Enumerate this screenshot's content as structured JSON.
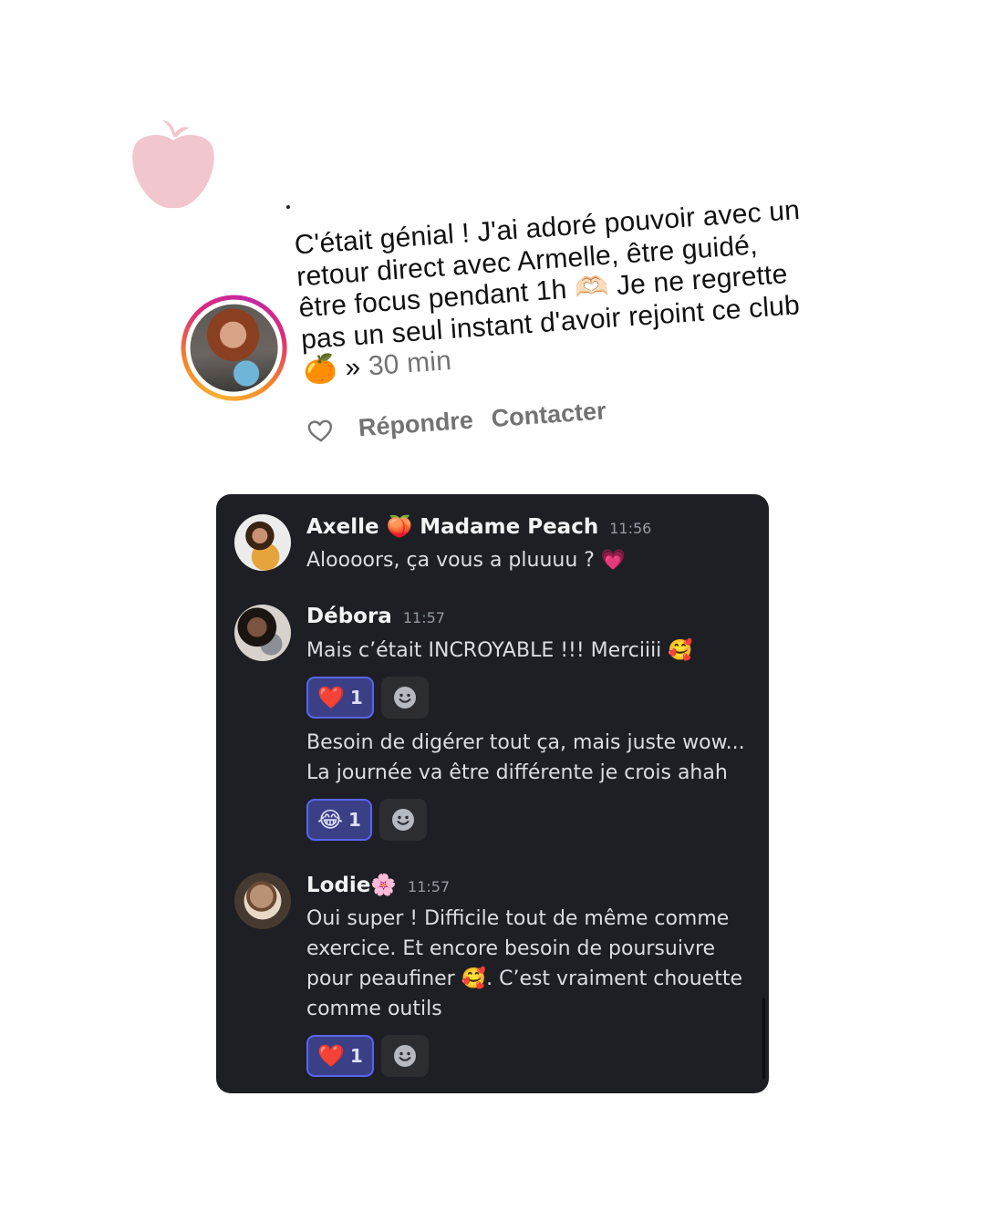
{
  "brand": {
    "logo_icon": "apple-icon",
    "logo_color": "#f2c6cf"
  },
  "instagram": {
    "comment_text": "C'était génial ! J'ai adoré pouvoir avec un retour direct avec Armelle, être guidé, être focus pendant 1h 🫶🏻 Je ne regrette pas un seul instant d'avoir rejoint ce club 🍊 »",
    "time": "30 min",
    "reply_label": "Répondre",
    "contact_label": "Contacter",
    "like_icon": "heart-outline-icon",
    "ring_colors": [
      "#f9b233",
      "#f58529",
      "#dd2a7b",
      "#c02aa5"
    ]
  },
  "discord": {
    "background": "#1e1f24",
    "messages": [
      {
        "author": "Axelle 🍑 Madame Peach",
        "time": "11:56",
        "lines": [
          "Aloooors, ça vous a pluuuu ? 💗"
        ]
      },
      {
        "author": "Débora",
        "time": "11:57",
        "lines": [
          "Mais c’était INCROYABLE !!! Merciiii 🥰",
          "Besoin de digérer tout ça, mais juste wow... La journée va être différente je crois ahah"
        ],
        "reactions": [
          {
            "emoji": "❤️",
            "count": "1"
          },
          {
            "emoji": "😂",
            "count": "1"
          }
        ]
      },
      {
        "author": "Lodie🌸",
        "time": "11:57",
        "lines": [
          "Oui super ! Difficile tout de même comme exercice. Et encore besoin de poursuivre pour peaufiner 🥰. C’est vraiment chouette comme outils"
        ],
        "reactions": [
          {
            "emoji": "❤️",
            "count": "1"
          }
        ]
      }
    ],
    "add_reaction_icon": "smiley-add-reaction-icon",
    "reaction_accent": "#5865f2"
  }
}
